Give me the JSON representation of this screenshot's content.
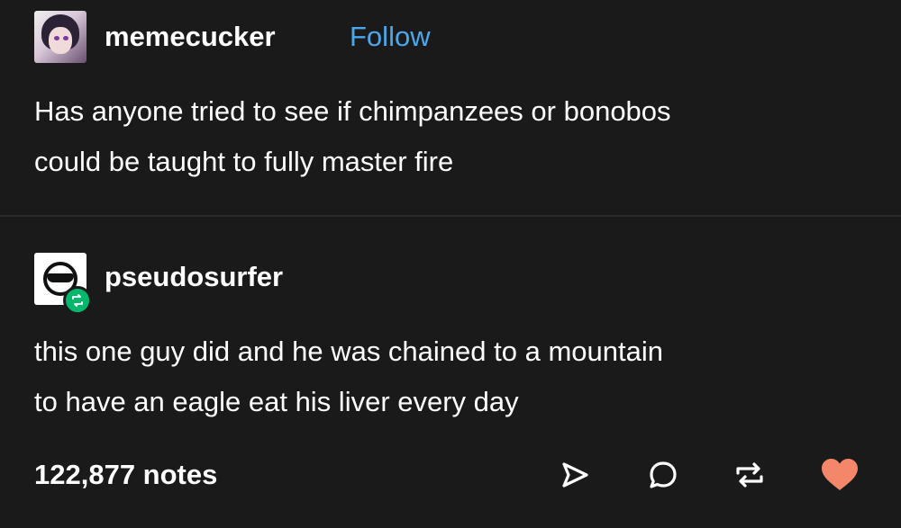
{
  "original_post": {
    "username": "memecucker",
    "follow_label": "Follow",
    "avatar_icon": "anime-avatar-icon",
    "lines": [
      "Has anyone tried to see if chimpanzees or bonobos",
      "could be taught to fully master fire"
    ]
  },
  "reblog": {
    "username": "pseudosurfer",
    "avatar_icon": "sunglasses-face-avatar-icon",
    "badge_icon": "reblog-badge-icon",
    "badge_color": "#00b86b",
    "lines": [
      "this one guy did and he was chained to a mountain",
      "to have an eagle eat his liver every day"
    ]
  },
  "footer": {
    "notes": "122,877 notes",
    "actions": {
      "share": "share-icon",
      "reply": "reply-icon",
      "reblog": "reblog-icon",
      "like": "heart-icon"
    },
    "like_color": "#f4866a"
  },
  "colors": {
    "background": "#1a1a1a",
    "text": "#ffffff",
    "follow": "#4aa8ea"
  }
}
